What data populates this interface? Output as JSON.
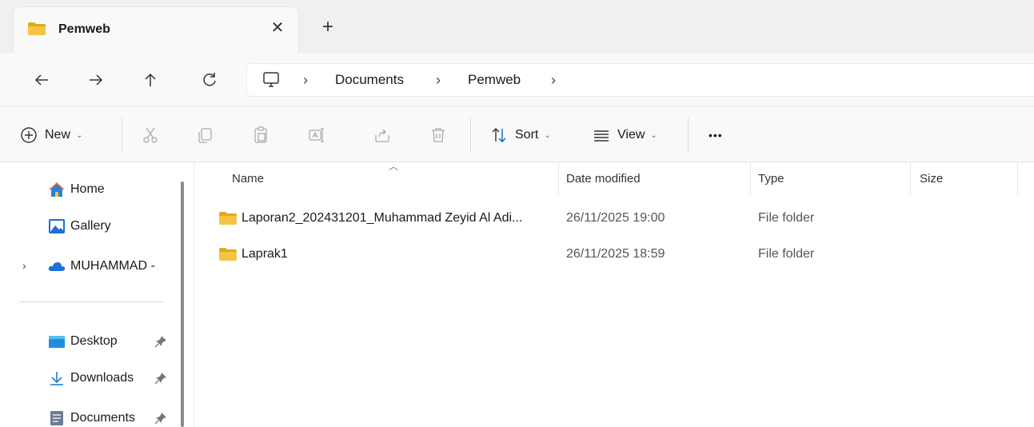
{
  "tab": {
    "title": "Pemweb",
    "close_glyph": "✕",
    "new_glyph": "+"
  },
  "nav": {
    "back_glyph": "←",
    "forward_glyph": "→",
    "up_glyph": "↑",
    "refresh_glyph": "↻"
  },
  "address": {
    "root_icon": "pc-icon",
    "separator": "›",
    "crumbs": [
      "Documents",
      "Pemweb"
    ]
  },
  "toolbar": {
    "new_label": "New",
    "sort_label": "Sort",
    "view_label": "View",
    "more_glyph": "•••",
    "chevron": "⌄"
  },
  "sidebar": {
    "items": [
      {
        "label": "Home",
        "icon": "home-icon"
      },
      {
        "label": "Gallery",
        "icon": "gallery-icon"
      },
      {
        "label": "MUHAMMAD -",
        "icon": "onedrive-icon",
        "expander": "›"
      },
      {
        "label": "Desktop",
        "icon": "desktop-icon",
        "pinned": true
      },
      {
        "label": "Downloads",
        "icon": "downloads-icon",
        "pinned": true
      },
      {
        "label": "Documents",
        "icon": "documents-icon",
        "pinned": true
      }
    ]
  },
  "columns": {
    "name": "Name",
    "date": "Date modified",
    "type": "Type",
    "size": "Size"
  },
  "files": [
    {
      "name": "Laporan2_202431201_Muhammad Zeyid Al Adi...",
      "date": "26/11/2025 19:00",
      "type": "File folder"
    },
    {
      "name": "Laprak1",
      "date": "26/11/2025 18:59",
      "type": "File folder"
    }
  ],
  "colors": {
    "folder": "#f5c542",
    "folder_dark": "#e0a91b",
    "accent": "#0067c0"
  }
}
